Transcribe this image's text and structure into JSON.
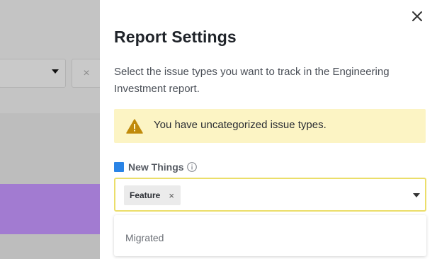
{
  "background": {
    "clear_symbol": "×"
  },
  "drawer": {
    "title": "Report Settings",
    "description": "Select the issue types you want to track in the Engineering Investment report.",
    "warning": {
      "icon": "warning-triangle-icon",
      "text": "You have uncategorized issue types."
    },
    "category": {
      "label": "New Things",
      "color": "#2a84e6",
      "info_icon": "info-icon",
      "selected": [
        {
          "label": "Feature",
          "remove_symbol": "×"
        }
      ],
      "options": [
        {
          "label": "Migrated"
        }
      ]
    }
  },
  "colors": {
    "accent_border": "#ebde6a",
    "warning_bg": "#fcf4c4",
    "warning_icon": "#c08a0b",
    "background_purple": "#a27bd1"
  }
}
